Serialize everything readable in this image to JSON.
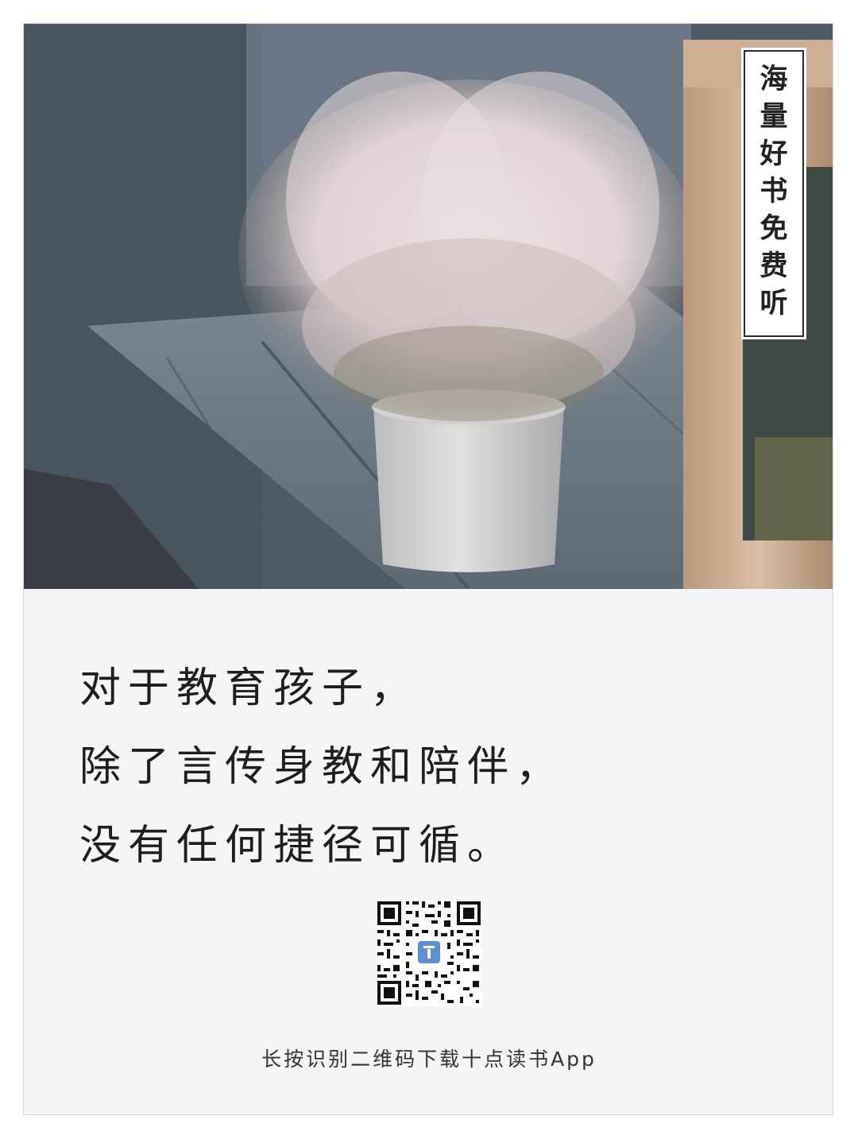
{
  "tag": {
    "text": "海量好书免费听",
    "chars": [
      "海",
      "量",
      "好",
      "书",
      "免",
      "费",
      "听"
    ]
  },
  "quote": {
    "lines": [
      "对于教育孩子，",
      "除了言传身教和陪伴，",
      "没有任何捷径可循。"
    ]
  },
  "qr": {
    "icon": "qr-code-icon"
  },
  "caption": "长按识别二维码下载十点读书App",
  "colors": {
    "card_background": "#f6f5f6",
    "text": "#1e1e1e",
    "tag_border": "#2b2b2b",
    "logo_blue": "#5e8fd2"
  }
}
